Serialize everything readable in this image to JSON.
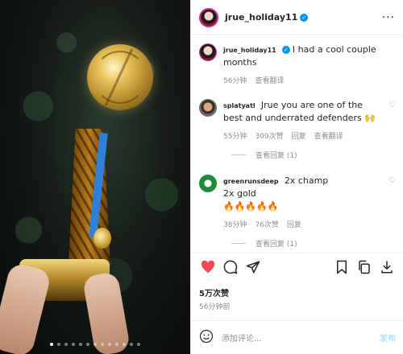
{
  "post": {
    "username": "jrue_holiday11",
    "caption_user": "jrue_holiday11",
    "caption": "I had a cool couple months",
    "caption_time": "56分钟",
    "see_translation": "查看翻译",
    "carousel_count": 13,
    "carousel_active": 0
  },
  "comments": [
    {
      "user": "splatyatl",
      "text": "Jrue you are one of the best and underrated defenders 🙌",
      "time": "55分钟",
      "likes": "309次赞",
      "reply": "回复",
      "translate": "查看翻译",
      "view_replies": "查看回复 (1)"
    },
    {
      "user": "greenrunsdeep",
      "text": "2x champ\n2x gold\n🔥🔥🔥🔥🔥",
      "time": "38分钟",
      "likes": "76次赞",
      "reply": "回复",
      "view_replies": "查看回复 (1)"
    }
  ],
  "stats": {
    "likes": "5万次赞",
    "time_ago": "56分钟前"
  },
  "composer": {
    "placeholder": "添加评论...",
    "post_label": "发布"
  },
  "colors": {
    "like_red": "#ed4956",
    "verified_blue": "#0095f6",
    "muted": "#8e8e8e"
  },
  "icons": [
    "heart-icon",
    "comment-icon",
    "share-icon",
    "save-icon",
    "copy-icon",
    "download-icon",
    "emoji-icon",
    "more-icon"
  ]
}
